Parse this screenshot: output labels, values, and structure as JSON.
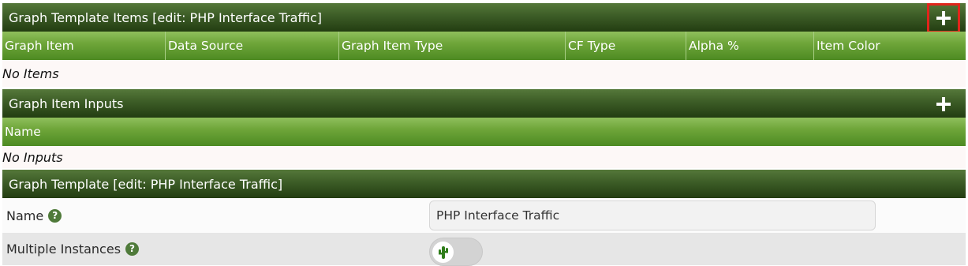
{
  "items_panel": {
    "title": "Graph Template Items [edit: PHP Interface Traffic]",
    "columns": [
      "Graph Item",
      "Data Source",
      "Graph Item Type",
      "CF Type",
      "Alpha %",
      "Item Color"
    ],
    "empty_text": "No Items",
    "add_icon": "plus-icon"
  },
  "inputs_panel": {
    "title": "Graph Item Inputs",
    "columns": [
      "Name"
    ],
    "empty_text": "No Inputs",
    "add_icon": "plus-icon"
  },
  "template_panel": {
    "title": "Graph Template [edit: PHP Interface Traffic]",
    "fields": {
      "name": {
        "label": "Name",
        "value": "PHP Interface Traffic",
        "help_icon": "question-circle-icon"
      },
      "multiple_instances": {
        "label": "Multiple Instances",
        "help_icon": "question-circle-icon",
        "toggle_icon": "cactus-icon"
      }
    }
  },
  "colors": {
    "header_dark": "#2c4a18",
    "column_green": "#6fa63a",
    "highlight_red": "#e0251b",
    "help_icon": "#4f7a3a"
  }
}
